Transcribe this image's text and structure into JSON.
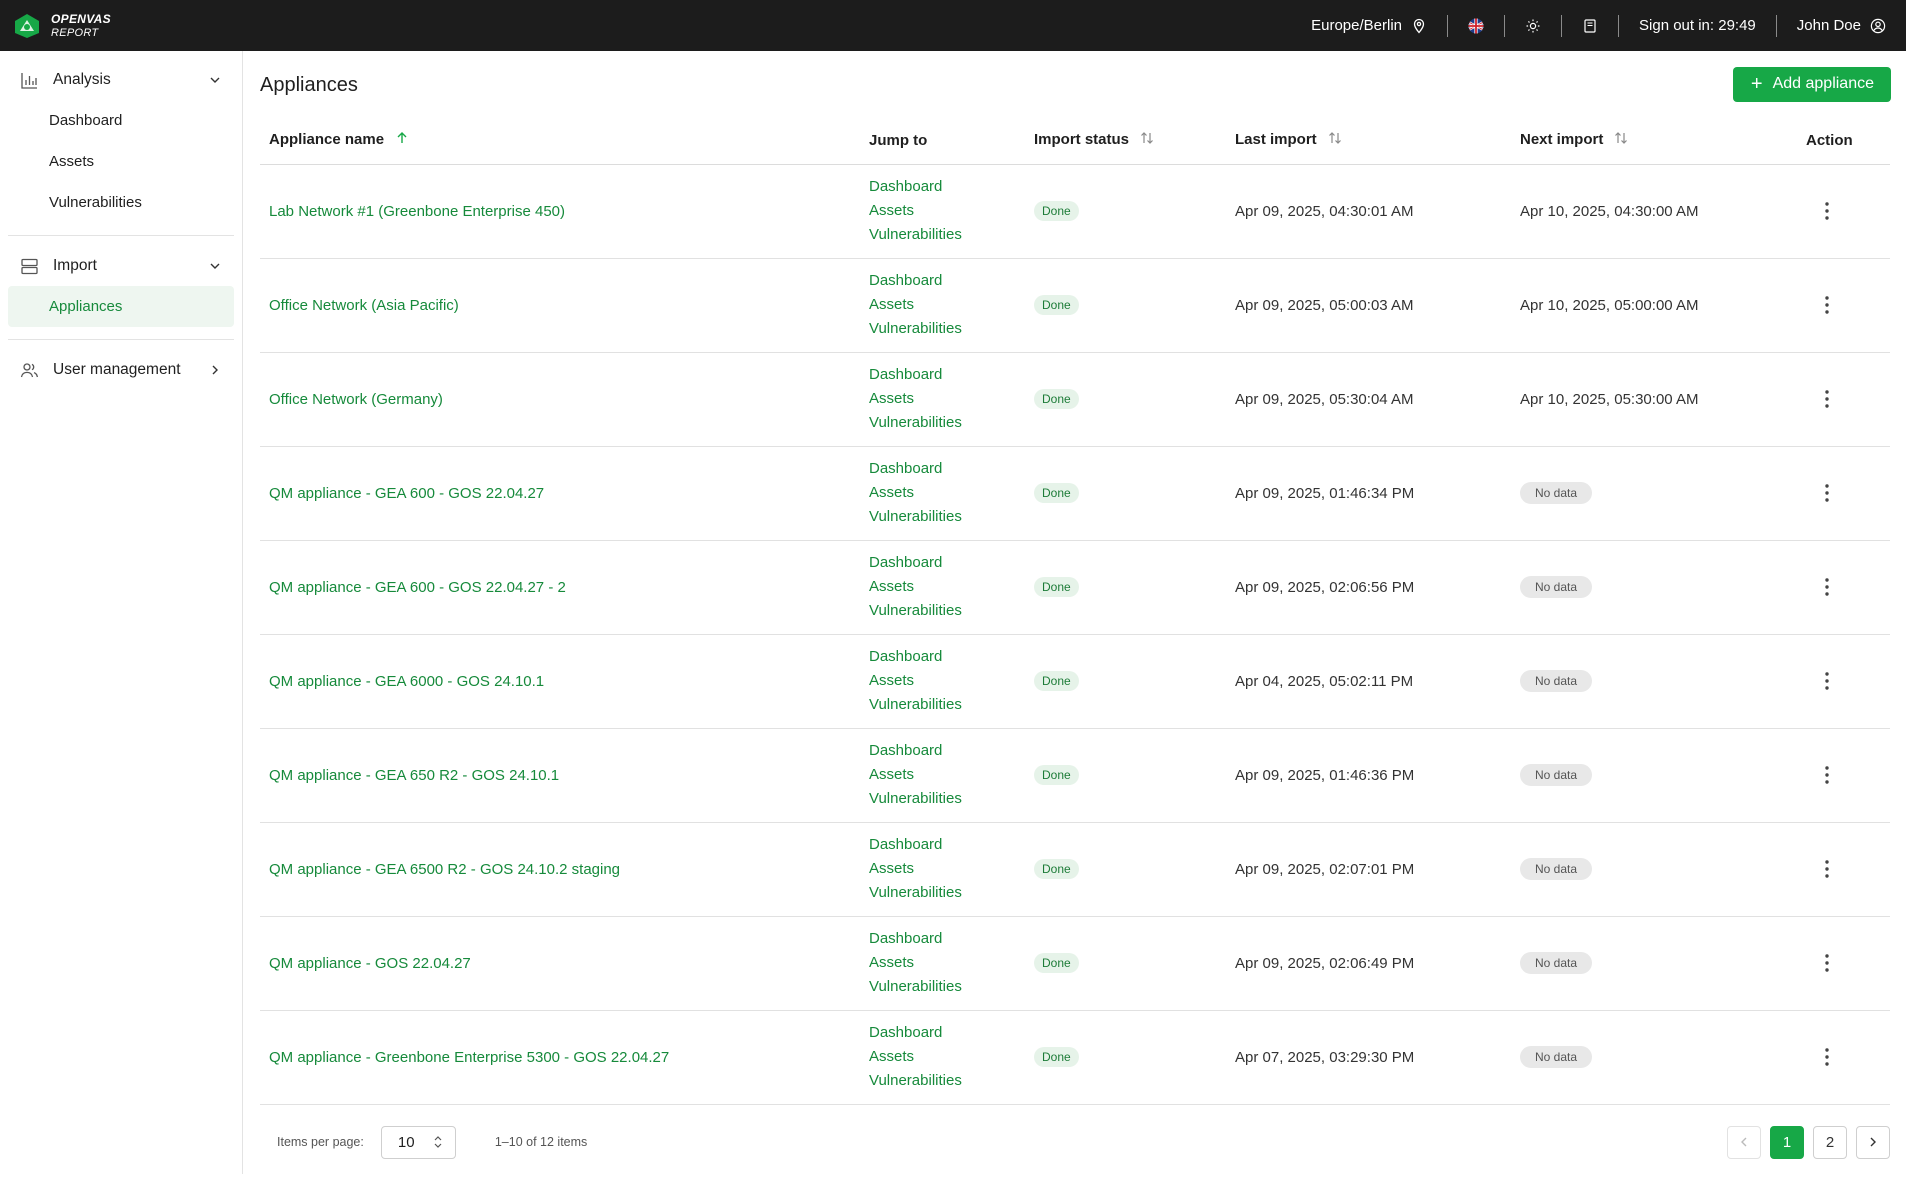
{
  "brand": {
    "line1": "OPENVAS",
    "line2": "REPORT"
  },
  "topbar": {
    "timezone": "Europe/Berlin",
    "sign_out": "Sign out in: 29:49",
    "user": "John Doe"
  },
  "sidebar": {
    "analysis": {
      "label": "Analysis",
      "items": [
        "Dashboard",
        "Assets",
        "Vulnerabilities"
      ]
    },
    "import": {
      "label": "Import",
      "items": [
        "Appliances"
      ]
    },
    "user_management": {
      "label": "User management"
    }
  },
  "page": {
    "title": "Appliances",
    "add_button": "Add appliance"
  },
  "table": {
    "columns": [
      "Appliance name",
      "Jump to",
      "Import status",
      "Last import",
      "Next import",
      "Action"
    ],
    "rows": [
      {
        "name": "Lab Network #1 (Greenbone Enterprise 450)",
        "jump": [
          "Dashboard",
          "Assets",
          "Vulnerabilities"
        ],
        "status": "Done",
        "last": "Apr 09, 2025, 04:30:01 AM",
        "next": "Apr 10, 2025, 04:30:00 AM"
      },
      {
        "name": "Office Network (Asia Pacific)",
        "jump": [
          "Dashboard",
          "Assets",
          "Vulnerabilities"
        ],
        "status": "Done",
        "last": "Apr 09, 2025, 05:00:03 AM",
        "next": "Apr 10, 2025, 05:00:00 AM"
      },
      {
        "name": "Office Network (Germany)",
        "jump": [
          "Dashboard",
          "Assets",
          "Vulnerabilities"
        ],
        "status": "Done",
        "last": "Apr 09, 2025, 05:30:04 AM",
        "next": "Apr 10, 2025, 05:30:00 AM"
      },
      {
        "name": "QM appliance - GEA 600 - GOS 22.04.27",
        "jump": [
          "Dashboard",
          "Assets",
          "Vulnerabilities"
        ],
        "status": "Done",
        "last": "Apr 09, 2025, 01:46:34 PM",
        "next": "No data"
      },
      {
        "name": "QM appliance - GEA 600 - GOS 22.04.27 - 2",
        "jump": [
          "Dashboard",
          "Assets",
          "Vulnerabilities"
        ],
        "status": "Done",
        "last": "Apr 09, 2025, 02:06:56 PM",
        "next": "No data"
      },
      {
        "name": "QM appliance - GEA 6000 - GOS 24.10.1",
        "jump": [
          "Dashboard",
          "Assets",
          "Vulnerabilities"
        ],
        "status": "Done",
        "last": "Apr 04, 2025, 05:02:11 PM",
        "next": "No data"
      },
      {
        "name": "QM appliance - GEA 650 R2 - GOS 24.10.1",
        "jump": [
          "Dashboard",
          "Assets",
          "Vulnerabilities"
        ],
        "status": "Done",
        "last": "Apr 09, 2025, 01:46:36 PM",
        "next": "No data"
      },
      {
        "name": "QM appliance - GEA 6500 R2 - GOS 24.10.2 staging",
        "jump": [
          "Dashboard",
          "Assets",
          "Vulnerabilities"
        ],
        "status": "Done",
        "last": "Apr 09, 2025, 02:07:01 PM",
        "next": "No data"
      },
      {
        "name": "QM appliance - GOS 22.04.27",
        "jump": [
          "Dashboard",
          "Assets",
          "Vulnerabilities"
        ],
        "status": "Done",
        "last": "Apr 09, 2025, 02:06:49 PM",
        "next": "No data"
      },
      {
        "name": "QM appliance - Greenbone Enterprise 5300 - GOS 22.04.27",
        "jump": [
          "Dashboard",
          "Assets",
          "Vulnerabilities"
        ],
        "status": "Done",
        "last": "Apr 07, 2025, 03:29:30 PM",
        "next": "No data"
      }
    ]
  },
  "pagination": {
    "items_per_page_label": "Items per page:",
    "items_per_page": "10",
    "range": "1–10 of 12 items",
    "pages": [
      "1",
      "2"
    ],
    "current_page": "1"
  },
  "colors": {
    "accent": "#17a847",
    "link": "#168a3b",
    "topbar": "#1c1c1c"
  }
}
